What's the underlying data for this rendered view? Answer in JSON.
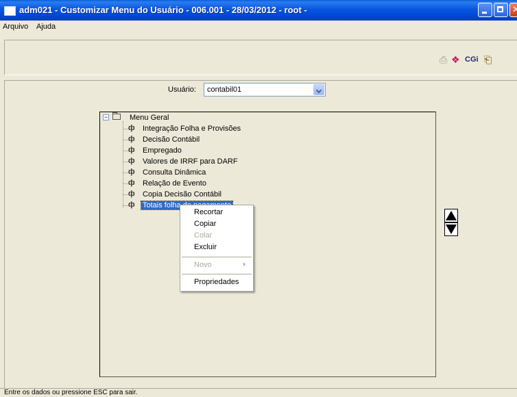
{
  "window": {
    "title": "adm021 - Customizar Menu do Usuário - 006.001 - 28/03/2012 - root -"
  },
  "menubar": {
    "items": [
      "Arquivo",
      "Ajuda"
    ]
  },
  "toolbar": {
    "icons": [
      "printer-icon",
      "book-icon",
      "cgi-icon",
      "exit-icon"
    ],
    "cgi_label": "CGi"
  },
  "user": {
    "label": "Usuário:",
    "value": "contabil01"
  },
  "tree": {
    "root_label": "Menu Geral",
    "items": [
      {
        "label": "Integração Folha e Provisões"
      },
      {
        "label": "Decisão Contábil"
      },
      {
        "label": "Empregado"
      },
      {
        "label": "Valores de IRRF para DARF"
      },
      {
        "label": "Consulta Dinâmica"
      },
      {
        "label": "Relação de Evento"
      },
      {
        "label": "Copia Decisão Contábil"
      },
      {
        "label": "Totais folha de pagamento",
        "selected": true
      }
    ]
  },
  "context_menu": {
    "items": [
      {
        "label": "Recortar",
        "enabled": true
      },
      {
        "label": "Copiar",
        "enabled": true
      },
      {
        "label": "Colar",
        "enabled": false
      },
      {
        "label": "Excluir",
        "enabled": true
      },
      {
        "label": "Novo",
        "enabled": false,
        "submenu": true
      },
      {
        "label": "Propriedades",
        "enabled": true
      }
    ]
  },
  "status": {
    "text": "Entre os dados ou pressione ESC para sair."
  },
  "colors": {
    "titlebar": "#0046d5",
    "selection": "#316ac5",
    "face": "#ece9d8"
  }
}
